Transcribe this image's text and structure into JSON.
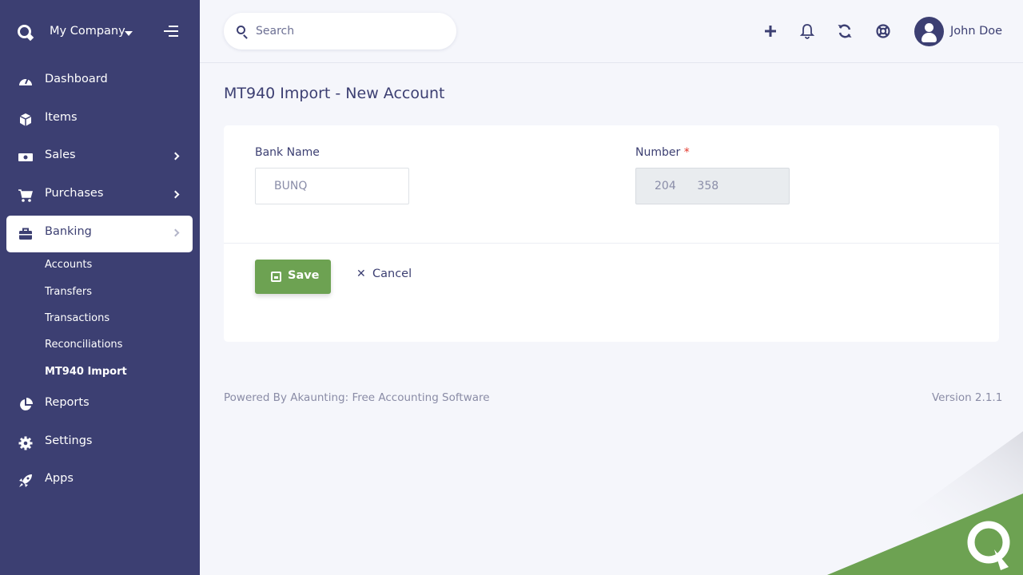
{
  "brand": {
    "company": "My Company"
  },
  "sidebar": {
    "items": [
      {
        "label": "Dashboard"
      },
      {
        "label": "Items"
      },
      {
        "label": "Sales"
      },
      {
        "label": "Purchases"
      },
      {
        "label": "Banking"
      },
      {
        "label": "Reports"
      },
      {
        "label": "Settings"
      },
      {
        "label": "Apps"
      }
    ],
    "banking_sub": [
      {
        "label": "Accounts"
      },
      {
        "label": "Transfers"
      },
      {
        "label": "Transactions"
      },
      {
        "label": "Reconciliations"
      },
      {
        "label": "MT940 Import"
      }
    ]
  },
  "header": {
    "search_placeholder": "Search",
    "user_name": "John Doe"
  },
  "page": {
    "title": "MT940 Import - New Account",
    "bank_name_label": "Bank Name",
    "bank_name_value": "BUNQ",
    "number_label": "Number",
    "number_required": "*",
    "number_value": "204      358",
    "save_label": "Save",
    "cancel_label": "Cancel"
  },
  "footer": {
    "powered_by": "Powered By Akaunting: Free Accounting Software",
    "version": "Version 2.1.1"
  },
  "colors": {
    "sidebar": "#3c3f72",
    "accent_green": "#6da252",
    "background": "#f5f6fb"
  }
}
